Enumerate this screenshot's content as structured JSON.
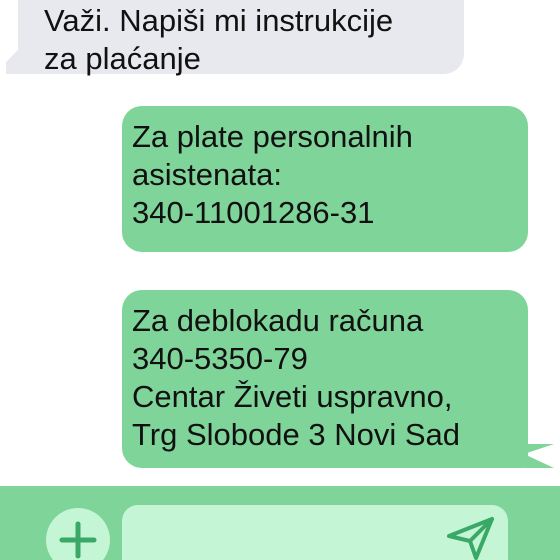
{
  "messages": [
    {
      "direction": "incoming",
      "text": "Važi. Napiši mi instrukcije\nza plaćanje"
    },
    {
      "direction": "outgoing",
      "text": "Za plate personalnih\nasistenata:\n340-11001286-31"
    },
    {
      "direction": "outgoing",
      "text": "Za deblokadu računa\n340-5350-79\nCentar Živeti uspravno,\nTrg Slobode 3 Novi Sad"
    }
  ],
  "composer": {
    "input_value": "",
    "add_icon": "plus-icon",
    "send_icon": "send-icon"
  },
  "colors": {
    "incoming_bubble": "#e8e9ee",
    "outgoing_bubble": "#7fd49a",
    "composer_bar": "#7fd49a",
    "composer_field": "#c4f5d4",
    "icon": "#3aa866"
  }
}
